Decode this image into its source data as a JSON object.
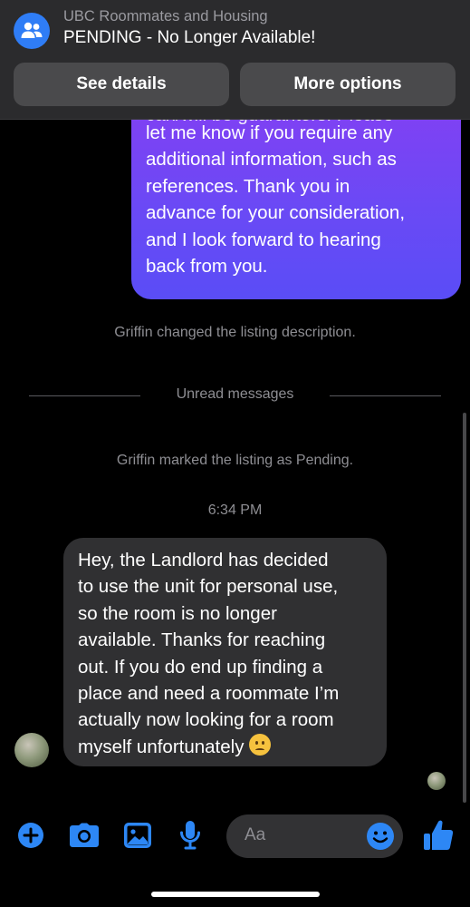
{
  "notification": {
    "app": "UBC Roommates and Housing",
    "title": "PENDING - No Longer Available!",
    "buttons": {
      "details": "See details",
      "more": "More options"
    },
    "icon": "group-icon"
  },
  "chat": {
    "outgoing": {
      "partial_line": "can/will be guarantors. Please",
      "text": "let me know if you require any\nadditional information, such as\nreferences. Thank you in\nadvance for your consideration,\nand I look forward to hearing\nback from you."
    },
    "system_1": "Griffin changed the listing description.",
    "divider": "Unread messages",
    "system_2": "Griffin marked the listing as Pending.",
    "timestamp": "6:34 PM",
    "incoming": {
      "text": "Hey, the Landlord has decided\nto use the unit for personal use,\nso the room is no longer\navailable. Thanks for reaching\nout. If you do end up finding a\nplace and need a roommate I’m\nactually now looking for a room\nmyself unfortunately",
      "emoji": "confused-face"
    }
  },
  "composer": {
    "placeholder": "Aa",
    "icons": [
      "plus-icon",
      "camera-icon",
      "image-icon",
      "microphone-icon",
      "emoji-icon",
      "thumbs-up-icon"
    ],
    "accent": "#2d87f5"
  }
}
